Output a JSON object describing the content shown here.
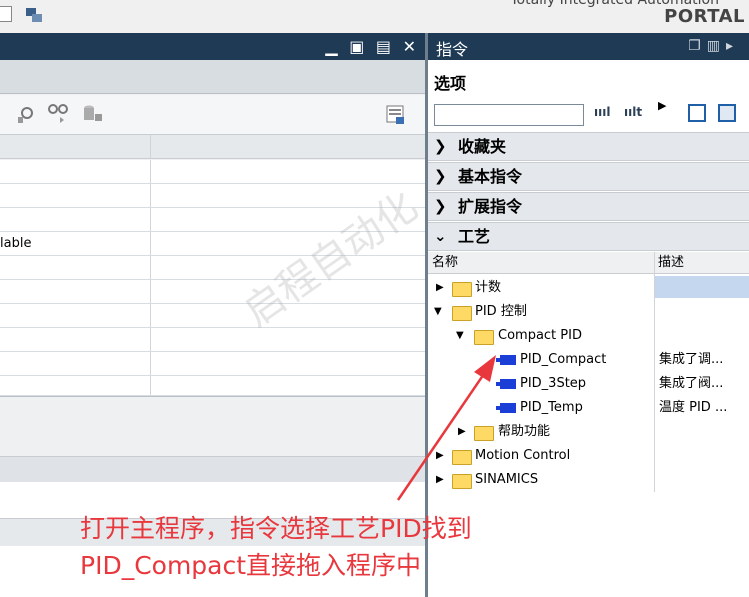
{
  "header": {
    "brand_line": "Totally Integrated Automation",
    "brand": "PORTAL"
  },
  "left_panel": {
    "window_buttons": "▁ ▣ ▤ ✕",
    "row_text": "lable"
  },
  "right_panel": {
    "title": "指令",
    "options_label": "选项",
    "search_placeholder": "",
    "search_buttons": [
      "ıııl",
      "ıılt"
    ],
    "sections": [
      {
        "label": "收藏夹",
        "expanded": false
      },
      {
        "label": "基本指令",
        "expanded": false
      },
      {
        "label": "扩展指令",
        "expanded": false
      },
      {
        "label": "工艺",
        "expanded": true
      }
    ],
    "tree_columns": {
      "name": "名称",
      "description": "描述"
    },
    "tree": [
      {
        "label": "计数",
        "type": "folder",
        "expanded": false,
        "desc": ""
      },
      {
        "label": "PID 控制",
        "type": "folder",
        "expanded": true,
        "desc": ""
      },
      {
        "label": "Compact PID",
        "type": "folder",
        "expanded": true,
        "desc": ""
      },
      {
        "label": "PID_Compact",
        "type": "block",
        "desc": "集成了调..."
      },
      {
        "label": "PID_3Step",
        "type": "block",
        "desc": "集成了阀..."
      },
      {
        "label": "PID_Temp",
        "type": "block",
        "desc": "温度 PID ..."
      },
      {
        "label": "帮助功能",
        "type": "folder",
        "expanded": false,
        "desc": ""
      },
      {
        "label": "Motion Control",
        "type": "folder",
        "expanded": false,
        "desc": ""
      },
      {
        "label": "SINAMICS",
        "type": "folder",
        "expanded": false,
        "desc": ""
      }
    ]
  },
  "watermark": "启程自动化",
  "annotation": {
    "line1": "打开主程序，指令选择工艺PID找到",
    "line2": "PID_Compact直接拖入程序中",
    "color": "#e8383d"
  }
}
